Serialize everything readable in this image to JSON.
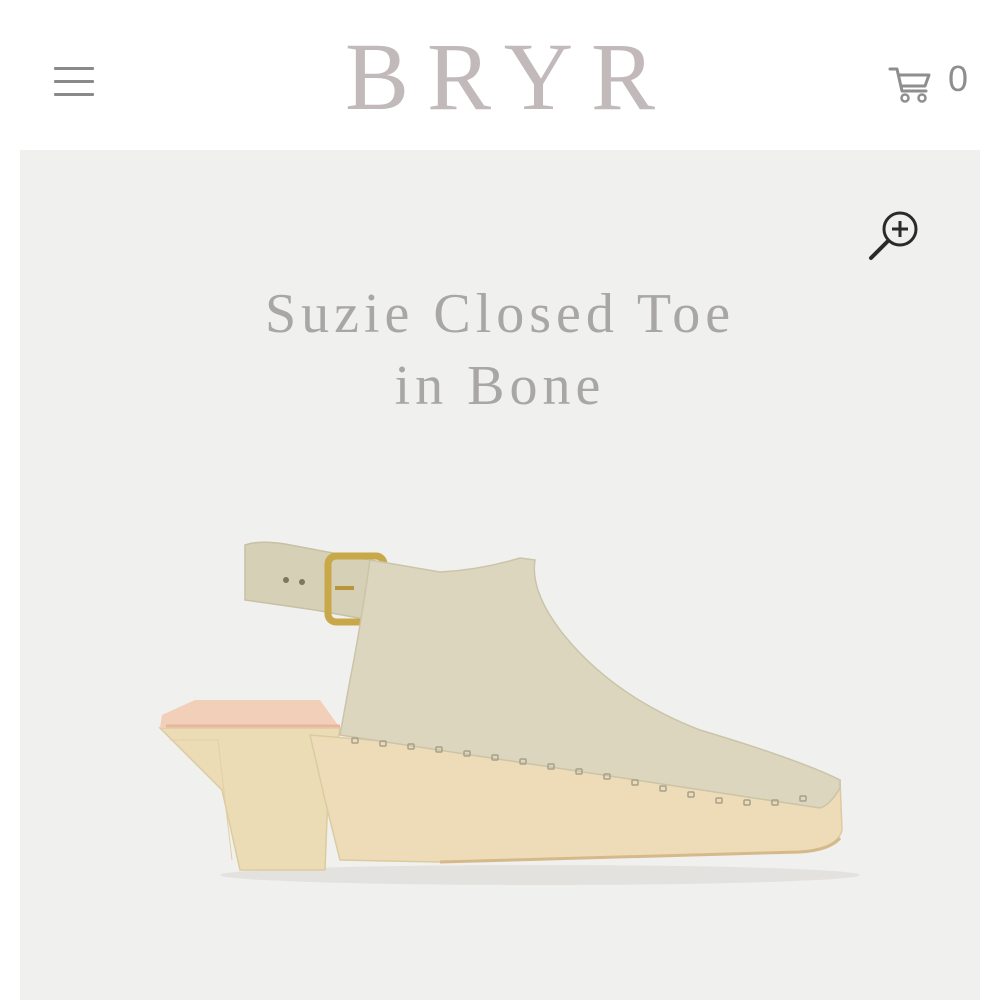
{
  "header": {
    "brand": "BRYR",
    "menu_icon": "hamburger-menu-icon",
    "cart_icon": "shopping-cart-icon",
    "cart_count": "0"
  },
  "product": {
    "title_line1": "Suzie Closed Toe",
    "title_line2": "in Bone",
    "zoom_icon": "zoom-in-icon",
    "image_subject": "clog",
    "colors": {
      "leather": "#dcd6bf",
      "wood": "#eadbb8",
      "background": "#f0f0ef",
      "buckle": "#c9a84a"
    }
  }
}
